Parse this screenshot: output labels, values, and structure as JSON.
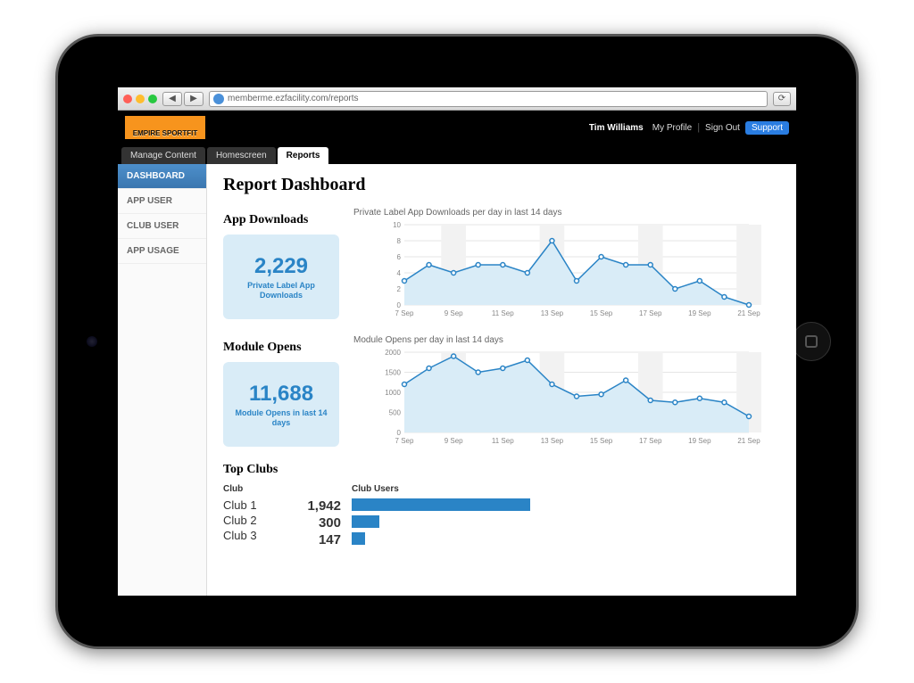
{
  "browser": {
    "url": "memberme.ezfacility.com/reports"
  },
  "header": {
    "brand": "EMPIRE SPORTFIT",
    "user": "Tim Williams",
    "my_profile": "My Profile",
    "sign_out": "Sign Out",
    "support": "Support"
  },
  "tabs": [
    {
      "label": "Manage Content",
      "active": false
    },
    {
      "label": "Homescreen",
      "active": false
    },
    {
      "label": "Reports",
      "active": true
    }
  ],
  "sidebar": [
    {
      "label": "DASHBOARD",
      "active": true
    },
    {
      "label": "APP USER",
      "active": false
    },
    {
      "label": "CLUB USER",
      "active": false
    },
    {
      "label": "APP USAGE",
      "active": false
    }
  ],
  "page_title": "Report Dashboard",
  "downloads": {
    "section_title": "App Downloads",
    "value": "2,229",
    "label": "Private Label App Downloads",
    "chart_title": "Private Label App Downloads per day in last 14 days"
  },
  "opens": {
    "section_title": "Module Opens",
    "value": "11,688",
    "label": "Module Opens in last 14 days",
    "chart_title": "Module Opens per day in last 14 days"
  },
  "top_clubs": {
    "section_title": "Top Clubs",
    "col_club": "Club",
    "col_users": "Club Users",
    "rows": [
      {
        "name": "Club 1",
        "users": "1,942"
      },
      {
        "name": "Club 2",
        "users": "300"
      },
      {
        "name": "Club 3",
        "users": "147"
      }
    ]
  },
  "chart_data": [
    {
      "type": "line",
      "title": "Private Label App Downloads per day in last 14 days",
      "xlabel": "",
      "ylabel": "",
      "ylim": [
        0,
        10
      ],
      "x_tick_labels": [
        "7 Sep",
        "9 Sep",
        "11 Sep",
        "13 Sep",
        "15 Sep",
        "17 Sep",
        "19 Sep",
        "21 Sep"
      ],
      "categories": [
        "7 Sep",
        "8 Sep",
        "9 Sep",
        "10 Sep",
        "11 Sep",
        "12 Sep",
        "13 Sep",
        "14 Sep",
        "15 Sep",
        "16 Sep",
        "17 Sep",
        "18 Sep",
        "19 Sep",
        "20 Sep",
        "21 Sep"
      ],
      "values": [
        3,
        5,
        4,
        5,
        5,
        4,
        8,
        3,
        6,
        5,
        5,
        2,
        3,
        1,
        0
      ]
    },
    {
      "type": "line",
      "title": "Module Opens per day in last 14 days",
      "xlabel": "",
      "ylabel": "",
      "ylim": [
        0,
        2000
      ],
      "x_tick_labels": [
        "7 Sep",
        "9 Sep",
        "11 Sep",
        "13 Sep",
        "15 Sep",
        "17 Sep",
        "19 Sep",
        "21 Sep"
      ],
      "categories": [
        "7 Sep",
        "8 Sep",
        "9 Sep",
        "10 Sep",
        "11 Sep",
        "12 Sep",
        "13 Sep",
        "14 Sep",
        "15 Sep",
        "16 Sep",
        "17 Sep",
        "18 Sep",
        "19 Sep",
        "20 Sep",
        "21 Sep"
      ],
      "values": [
        1200,
        1600,
        1900,
        1500,
        1600,
        1800,
        1200,
        900,
        950,
        1300,
        800,
        750,
        850,
        750,
        400
      ]
    },
    {
      "type": "bar",
      "title": "Top Clubs — Club Users",
      "categories": [
        "Club 1",
        "Club 2",
        "Club 3"
      ],
      "values": [
        1942,
        300,
        147
      ]
    }
  ]
}
